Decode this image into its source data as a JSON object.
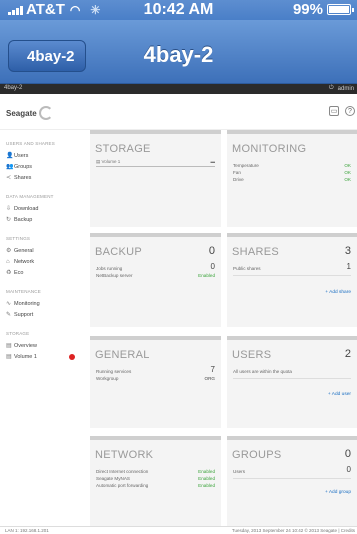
{
  "status_bar": {
    "carrier": "AT&T",
    "time": "10:42 AM",
    "battery": "99%",
    "battery_level": 0.99
  },
  "nav": {
    "back_label": "4bay-2",
    "title": "4bay-2"
  },
  "app_header": {
    "device": "4bay-2",
    "user": "admin"
  },
  "logo": {
    "text": "Seagate"
  },
  "sidebar": {
    "sections": [
      {
        "title": "USERS AND SHARES",
        "items": [
          {
            "label": "Users",
            "icon": "user-icon"
          },
          {
            "label": "Groups",
            "icon": "group-icon"
          },
          {
            "label": "Shares",
            "icon": "share-icon"
          }
        ]
      },
      {
        "title": "DATA MANAGEMENT",
        "items": [
          {
            "label": "Download",
            "icon": "download-icon"
          },
          {
            "label": "Backup",
            "icon": "backup-icon"
          }
        ]
      },
      {
        "title": "SETTINGS",
        "items": [
          {
            "label": "General",
            "icon": "gear-icon"
          },
          {
            "label": "Network",
            "icon": "network-icon"
          },
          {
            "label": "Eco",
            "icon": "eco-icon"
          }
        ]
      },
      {
        "title": "MAINTENANCE",
        "items": [
          {
            "label": "Monitoring",
            "icon": "monitoring-icon"
          },
          {
            "label": "Support",
            "icon": "support-icon"
          }
        ]
      },
      {
        "title": "STORAGE",
        "items": [
          {
            "label": "Overview",
            "icon": "storage-icon"
          },
          {
            "label": "Volume 1",
            "icon": "volume-icon",
            "alert": true
          }
        ]
      }
    ]
  },
  "panels": {
    "storage": {
      "title": "STORAGE",
      "volume": "Volume 1"
    },
    "monitoring": {
      "title": "MONITORING",
      "rows": [
        {
          "label": "Temperature",
          "value": "OK"
        },
        {
          "label": "Fan",
          "value": "OK"
        },
        {
          "label": "Drive",
          "value": "OK"
        }
      ]
    },
    "backup": {
      "title": "BACKUP",
      "count": "0",
      "rows": [
        {
          "label": "Jobs running",
          "value": "0"
        },
        {
          "label": "NetBackup server",
          "value": "Enabled"
        }
      ]
    },
    "shares": {
      "title": "SHARES",
      "count": "3",
      "rows": [
        {
          "label": "Public shares",
          "value": "1"
        }
      ],
      "add_link": "+ Add share"
    },
    "general": {
      "title": "GENERAL",
      "rows": [
        {
          "label": "Running services",
          "value": "7"
        },
        {
          "label": "Workgroup",
          "value": "ORG"
        }
      ]
    },
    "users": {
      "title": "USERS",
      "count": "2",
      "note": "All users are within the quota",
      "add_link": "+ Add user"
    },
    "network": {
      "title": "NETWORK",
      "rows": [
        {
          "label": "Direct Internet connection",
          "value": "Enabled"
        },
        {
          "label": "Seagate MyNAS",
          "value": "Enabled"
        },
        {
          "label": "Automatic port forwarding",
          "value": "Enabled"
        }
      ]
    },
    "groups": {
      "title": "GROUPS",
      "count": "0",
      "rows": [
        {
          "label": "Users",
          "value": "0"
        }
      ],
      "add_link": "+ Add group"
    }
  },
  "footer": {
    "ip": "LAN 1: 192.168.1.201",
    "info": "Tuesday, 2013 September 24   10:42   © 2013 Seagate | Credits"
  }
}
